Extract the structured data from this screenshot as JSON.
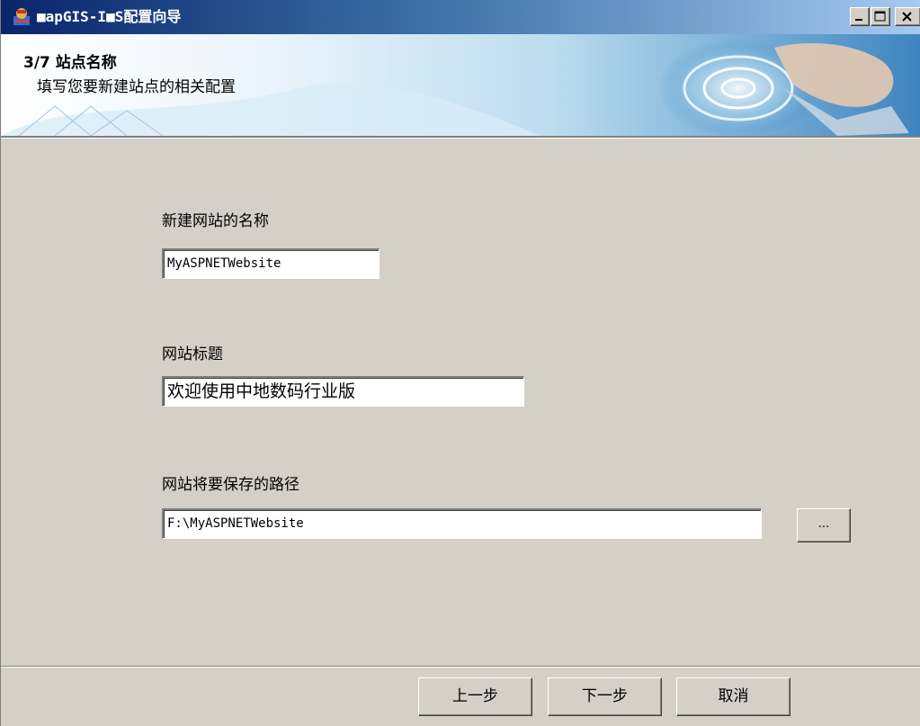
{
  "window": {
    "title": "■apGIS-I■S配置向导"
  },
  "header": {
    "step_title": "3/7 站点名称",
    "step_subtitle": "填写您要新建站点的相关配置"
  },
  "form": {
    "site_name_label": "新建网站的名称",
    "site_name_value": "MyASPNETWebsite",
    "site_title_label": "网站标题",
    "site_title_value": "欢迎使用中地数码行业版",
    "save_path_label": "网站将要保存的路径",
    "save_path_value": "F:\\MyASPNETWebsite",
    "browse_label": "..."
  },
  "footer": {
    "prev_label": "上一步",
    "next_label": "下一步",
    "cancel_label": "取消"
  },
  "icons": {
    "app": "app-icon",
    "minimize": "minimize-icon",
    "maximize": "maximize-icon",
    "close": "close-icon"
  },
  "colors": {
    "titlebar_start": "#0a246a",
    "titlebar_end": "#a6caf0",
    "dialog_bg": "#d4d0c8"
  }
}
